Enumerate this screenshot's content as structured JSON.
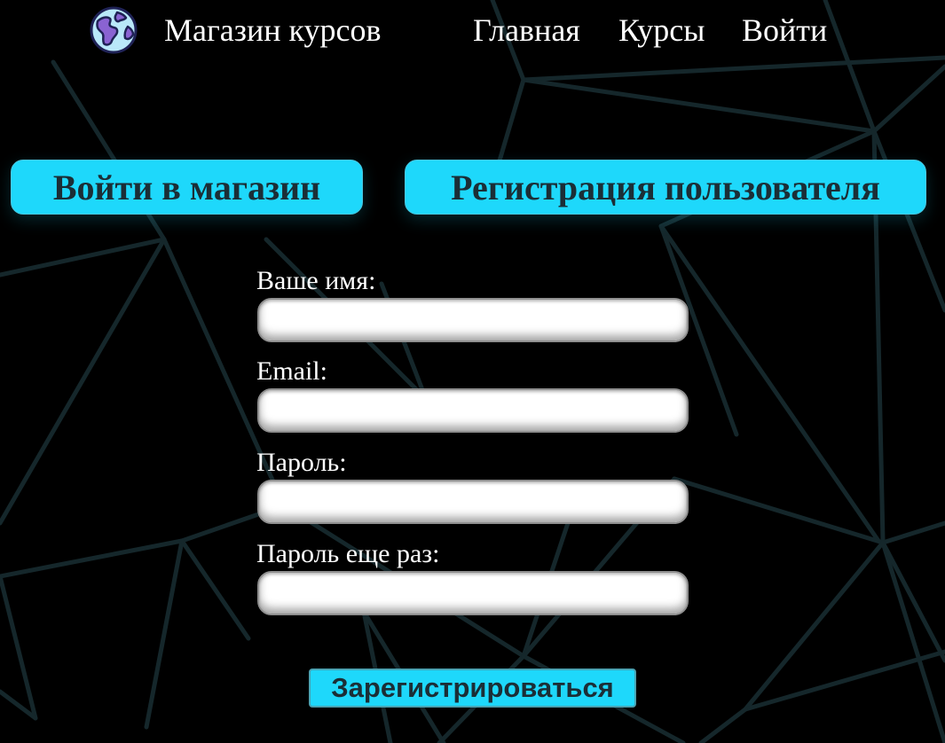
{
  "header": {
    "brand": "Магазин курсов",
    "logo_icon": "globe-icon",
    "nav": {
      "home": "Главная",
      "courses": "Курсы",
      "login": "Войти"
    }
  },
  "tabs": {
    "login": "Войти в магазин",
    "register": "Регистрация пользователя"
  },
  "form": {
    "fields": [
      {
        "label": "Ваше имя:",
        "value": ""
      },
      {
        "label": "Email:",
        "value": ""
      },
      {
        "label": "Пароль:",
        "value": ""
      },
      {
        "label": "Пароль еще раз:",
        "value": ""
      }
    ],
    "submit": "Зарегистрироваться"
  },
  "colors": {
    "background": "#000000",
    "accent": "#1ed8fb",
    "accent_text": "#1b2e36",
    "pattern_lines": "#15272b"
  }
}
